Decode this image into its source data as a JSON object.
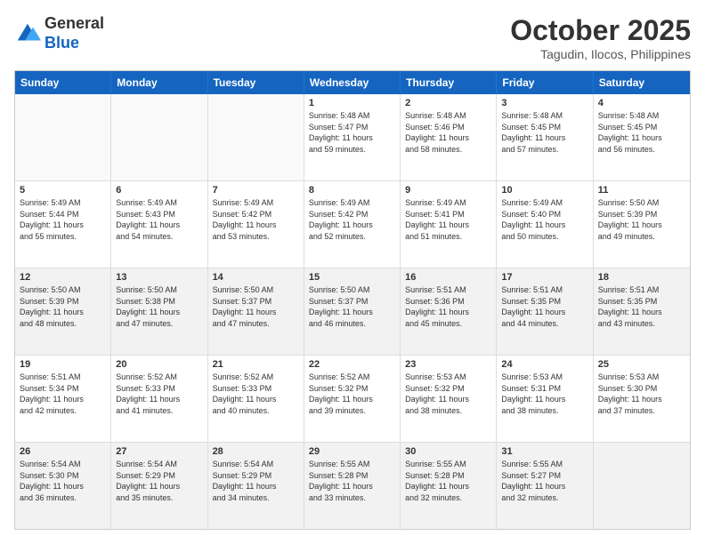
{
  "logo": {
    "general": "General",
    "blue": "Blue"
  },
  "title": "October 2025",
  "subtitle": "Tagudin, Ilocos, Philippines",
  "dayNames": [
    "Sunday",
    "Monday",
    "Tuesday",
    "Wednesday",
    "Thursday",
    "Friday",
    "Saturday"
  ],
  "weeks": [
    [
      {
        "day": "",
        "info": "",
        "empty": true
      },
      {
        "day": "",
        "info": "",
        "empty": true
      },
      {
        "day": "",
        "info": "",
        "empty": true
      },
      {
        "day": "1",
        "info": "Sunrise: 5:48 AM\nSunset: 5:47 PM\nDaylight: 11 hours\nand 59 minutes."
      },
      {
        "day": "2",
        "info": "Sunrise: 5:48 AM\nSunset: 5:46 PM\nDaylight: 11 hours\nand 58 minutes."
      },
      {
        "day": "3",
        "info": "Sunrise: 5:48 AM\nSunset: 5:45 PM\nDaylight: 11 hours\nand 57 minutes."
      },
      {
        "day": "4",
        "info": "Sunrise: 5:48 AM\nSunset: 5:45 PM\nDaylight: 11 hours\nand 56 minutes."
      }
    ],
    [
      {
        "day": "5",
        "info": "Sunrise: 5:49 AM\nSunset: 5:44 PM\nDaylight: 11 hours\nand 55 minutes."
      },
      {
        "day": "6",
        "info": "Sunrise: 5:49 AM\nSunset: 5:43 PM\nDaylight: 11 hours\nand 54 minutes."
      },
      {
        "day": "7",
        "info": "Sunrise: 5:49 AM\nSunset: 5:42 PM\nDaylight: 11 hours\nand 53 minutes."
      },
      {
        "day": "8",
        "info": "Sunrise: 5:49 AM\nSunset: 5:42 PM\nDaylight: 11 hours\nand 52 minutes."
      },
      {
        "day": "9",
        "info": "Sunrise: 5:49 AM\nSunset: 5:41 PM\nDaylight: 11 hours\nand 51 minutes."
      },
      {
        "day": "10",
        "info": "Sunrise: 5:49 AM\nSunset: 5:40 PM\nDaylight: 11 hours\nand 50 minutes."
      },
      {
        "day": "11",
        "info": "Sunrise: 5:50 AM\nSunset: 5:39 PM\nDaylight: 11 hours\nand 49 minutes."
      }
    ],
    [
      {
        "day": "12",
        "info": "Sunrise: 5:50 AM\nSunset: 5:39 PM\nDaylight: 11 hours\nand 48 minutes.",
        "shaded": true
      },
      {
        "day": "13",
        "info": "Sunrise: 5:50 AM\nSunset: 5:38 PM\nDaylight: 11 hours\nand 47 minutes.",
        "shaded": true
      },
      {
        "day": "14",
        "info": "Sunrise: 5:50 AM\nSunset: 5:37 PM\nDaylight: 11 hours\nand 47 minutes.",
        "shaded": true
      },
      {
        "day": "15",
        "info": "Sunrise: 5:50 AM\nSunset: 5:37 PM\nDaylight: 11 hours\nand 46 minutes.",
        "shaded": true
      },
      {
        "day": "16",
        "info": "Sunrise: 5:51 AM\nSunset: 5:36 PM\nDaylight: 11 hours\nand 45 minutes.",
        "shaded": true
      },
      {
        "day": "17",
        "info": "Sunrise: 5:51 AM\nSunset: 5:35 PM\nDaylight: 11 hours\nand 44 minutes.",
        "shaded": true
      },
      {
        "day": "18",
        "info": "Sunrise: 5:51 AM\nSunset: 5:35 PM\nDaylight: 11 hours\nand 43 minutes.",
        "shaded": true
      }
    ],
    [
      {
        "day": "19",
        "info": "Sunrise: 5:51 AM\nSunset: 5:34 PM\nDaylight: 11 hours\nand 42 minutes."
      },
      {
        "day": "20",
        "info": "Sunrise: 5:52 AM\nSunset: 5:33 PM\nDaylight: 11 hours\nand 41 minutes."
      },
      {
        "day": "21",
        "info": "Sunrise: 5:52 AM\nSunset: 5:33 PM\nDaylight: 11 hours\nand 40 minutes."
      },
      {
        "day": "22",
        "info": "Sunrise: 5:52 AM\nSunset: 5:32 PM\nDaylight: 11 hours\nand 39 minutes."
      },
      {
        "day": "23",
        "info": "Sunrise: 5:53 AM\nSunset: 5:32 PM\nDaylight: 11 hours\nand 38 minutes."
      },
      {
        "day": "24",
        "info": "Sunrise: 5:53 AM\nSunset: 5:31 PM\nDaylight: 11 hours\nand 38 minutes."
      },
      {
        "day": "25",
        "info": "Sunrise: 5:53 AM\nSunset: 5:30 PM\nDaylight: 11 hours\nand 37 minutes."
      }
    ],
    [
      {
        "day": "26",
        "info": "Sunrise: 5:54 AM\nSunset: 5:30 PM\nDaylight: 11 hours\nand 36 minutes.",
        "shaded": true
      },
      {
        "day": "27",
        "info": "Sunrise: 5:54 AM\nSunset: 5:29 PM\nDaylight: 11 hours\nand 35 minutes.",
        "shaded": true
      },
      {
        "day": "28",
        "info": "Sunrise: 5:54 AM\nSunset: 5:29 PM\nDaylight: 11 hours\nand 34 minutes.",
        "shaded": true
      },
      {
        "day": "29",
        "info": "Sunrise: 5:55 AM\nSunset: 5:28 PM\nDaylight: 11 hours\nand 33 minutes.",
        "shaded": true
      },
      {
        "day": "30",
        "info": "Sunrise: 5:55 AM\nSunset: 5:28 PM\nDaylight: 11 hours\nand 32 minutes.",
        "shaded": true
      },
      {
        "day": "31",
        "info": "Sunrise: 5:55 AM\nSunset: 5:27 PM\nDaylight: 11 hours\nand 32 minutes.",
        "shaded": true
      },
      {
        "day": "",
        "info": "",
        "empty": true,
        "shaded": true
      }
    ]
  ]
}
